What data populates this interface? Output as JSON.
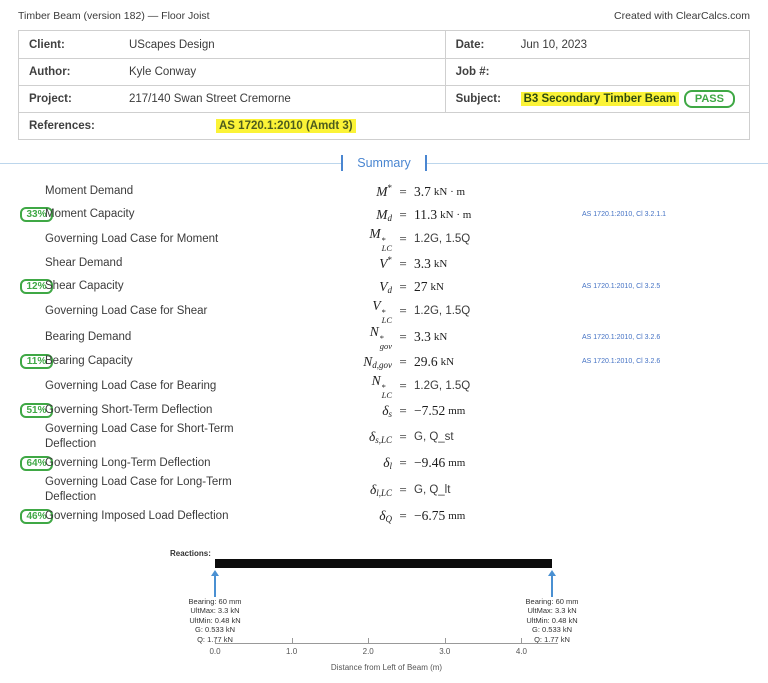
{
  "header": {
    "title": "Timber Beam (version 182) — Floor Joist",
    "credit": "Created with ClearCalcs.com"
  },
  "info_table": {
    "row1": {
      "label_left": "Client:",
      "value_left": "UScapes Design",
      "label_right": "Date:",
      "value_right": "Jun 10, 2023"
    },
    "row2": {
      "label_left": "Author:",
      "value_left": "Kyle Conway",
      "label_right": "Job #:",
      "value_right": ""
    },
    "row3": {
      "label_left": "Project:",
      "value_left": "217/140 Swan Street Cremorne",
      "label_right": "Subject:",
      "value_right": "B3 Secondary Timber Beam",
      "status_badge": "PASS"
    },
    "row4": {
      "label": "References:",
      "value": "AS 1720.1:2010 (Amdt 3)"
    }
  },
  "summary": {
    "title": "Summary",
    "rows": [
      {
        "badge": "",
        "label": "Moment Demand",
        "sym": "M",
        "sup": "*",
        "sub": "",
        "value": "3.7",
        "unit": "kN · m",
        "sans": false,
        "ref": ""
      },
      {
        "badge": "33%",
        "label": "Moment Capacity",
        "sym": "M",
        "sup": "",
        "sub": "d",
        "value": "11.3",
        "unit": "kN · m",
        "sans": false,
        "ref": "AS 1720.1:2010, Cl 3.2.1.1"
      },
      {
        "badge": "",
        "label": "Governing Load Case for Moment",
        "sym": "M",
        "sup": "*",
        "sub": "LC",
        "value": "1.2G, 1.5Q",
        "unit": "",
        "sans": true,
        "ref": ""
      },
      {
        "badge": "",
        "label": "Shear Demand",
        "sym": "V",
        "sup": "*",
        "sub": "",
        "value": "3.3",
        "unit": "kN",
        "sans": false,
        "ref": ""
      },
      {
        "badge": "12%",
        "label": "Shear Capacity",
        "sym": "V",
        "sup": "",
        "sub": "d",
        "value": "27",
        "unit": "kN",
        "sans": false,
        "ref": "AS 1720.1:2010, Cl 3.2.5"
      },
      {
        "badge": "",
        "label": "Governing Load Case for Shear",
        "sym": "V",
        "sup": "*",
        "sub": "LC",
        "value": "1.2G, 1.5Q",
        "unit": "",
        "sans": true,
        "ref": ""
      },
      {
        "badge": "",
        "label": "Bearing Demand",
        "sym": "N",
        "sup": "*",
        "sub": "gov",
        "value": "3.3",
        "unit": "kN",
        "sans": false,
        "ref": "AS 1720.1:2010, Cl 3.2.6"
      },
      {
        "badge": "11%",
        "label": "Bearing Capacity",
        "sym": "N",
        "sup": "",
        "sub": "d,gov",
        "value": "29.6",
        "unit": "kN",
        "sans": false,
        "ref": "AS 1720.1:2010, Cl 3.2.6"
      },
      {
        "badge": "",
        "label": "Governing Load Case for Bearing",
        "sym": "N",
        "sup": "*",
        "sub": "LC",
        "value": "1.2G, 1.5Q",
        "unit": "",
        "sans": true,
        "ref": ""
      },
      {
        "badge": "51%",
        "label": "Governing Short-Term Deflection",
        "sym": "δ",
        "sup": "",
        "sub": "s",
        "value": "−7.52",
        "unit": "mm",
        "sans": false,
        "ref": ""
      },
      {
        "badge": "",
        "label": "Governing Load Case for Short-Term Deflection",
        "sym": "δ",
        "sup": "",
        "sub": "s,LC",
        "value": "G, Q_st",
        "unit": "",
        "sans": true,
        "ref": ""
      },
      {
        "badge": "64%",
        "label": "Governing Long-Term Deflection",
        "sym": "δ",
        "sup": "",
        "sub": "l",
        "value": "−9.46",
        "unit": "mm",
        "sans": false,
        "ref": ""
      },
      {
        "badge": "",
        "label": "Governing Load Case for Long-Term Deflection",
        "sym": "δ",
        "sup": "",
        "sub": "l,LC",
        "value": "G, Q_lt",
        "unit": "",
        "sans": true,
        "ref": ""
      },
      {
        "badge": "46%",
        "label": "Governing Imposed Load Deflection",
        "sym": "δ",
        "sup": "",
        "sub": "Q",
        "value": "−6.75",
        "unit": "mm",
        "sans": false,
        "ref": ""
      }
    ]
  },
  "reactions_diagram": {
    "label": "Reactions:",
    "beam_span_m": [
      0.0,
      4.4
    ],
    "supports": [
      {
        "position_m": 0.0,
        "lines": [
          "Bearing: 60 mm",
          "UltMax: 3.3 kN",
          "UltMin: 0.48 kN",
          "G: 0.533 kN",
          "Q: 1.77 kN"
        ]
      },
      {
        "position_m": 4.4,
        "lines": [
          "Bearing: 60 mm",
          "UltMax: 3.3 kN",
          "UltMin: 0.48 kN",
          "G: 0.533 kN",
          "Q: 1.77 kN"
        ]
      }
    ],
    "axis": {
      "tick_labels": [
        "0.0",
        "1.0",
        "2.0",
        "3.0",
        "4.0"
      ],
      "tick_values_m": [
        0,
        1,
        2,
        3,
        4
      ],
      "title": "Distance from Left of Beam (m)"
    },
    "colors": {
      "beam": "#0c0c0c",
      "arrow": "#4a90d2"
    }
  },
  "colors": {
    "green": "#3fa845",
    "highlight_yellow": "#fbf337",
    "summary_blue": "#4a86d1",
    "ref_blue": "#4472c4"
  }
}
